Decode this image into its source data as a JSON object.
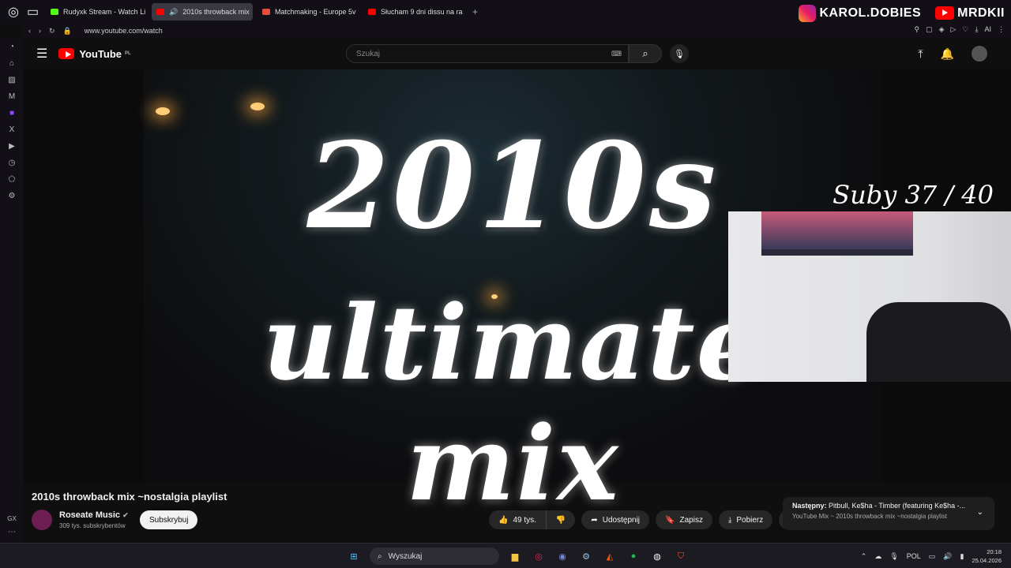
{
  "browser": {
    "tabs": [
      {
        "label": "Rudyxk Stream - Watch Li",
        "color": "#53fc18",
        "active": false
      },
      {
        "label": "2010s throwback mix",
        "color": "#ff0000",
        "active": true
      },
      {
        "label": "Matchmaking - Europe 5v",
        "color": "#e74c3c",
        "active": false
      },
      {
        "label": "Słucham 9 dni dissu na ra",
        "color": "#ff0000",
        "active": false
      }
    ],
    "url": "www.youtube.com/watch",
    "addr_ai": "AI"
  },
  "stream_overlay": {
    "instagram": "KAROL.DOBIES",
    "youtube": "MRDKII",
    "sub_goal": "Suby 37 / 40"
  },
  "youtube": {
    "logo": "YouTube",
    "region": "PL",
    "search_placeholder": "Szukaj"
  },
  "video": {
    "thumb_line1": "2010s",
    "thumb_line2": "ultimate mix",
    "title": "2010s throwback mix ~nostalgia playlist",
    "channel": "Roseate Music",
    "channel_subs": "309 tys. subskrybentów",
    "subscribe": "Subskrybuj",
    "likes": "49 tys.",
    "share": "Udostępnij",
    "save": "Zapisz",
    "download": "Pobierz"
  },
  "next_up": {
    "label": "Następny:",
    "title": "Pitbull, Ke$ha - Timber (featuring Ke$ha -...",
    "source": "YouTube Mix ~ 2010s throwback mix ~nostalgia playlist"
  },
  "taskbar": {
    "search": "Wyszukaj",
    "lang": "POL",
    "time": "20:18",
    "date": "25.04.2026"
  },
  "sidebar": {
    "gx": "GX"
  }
}
